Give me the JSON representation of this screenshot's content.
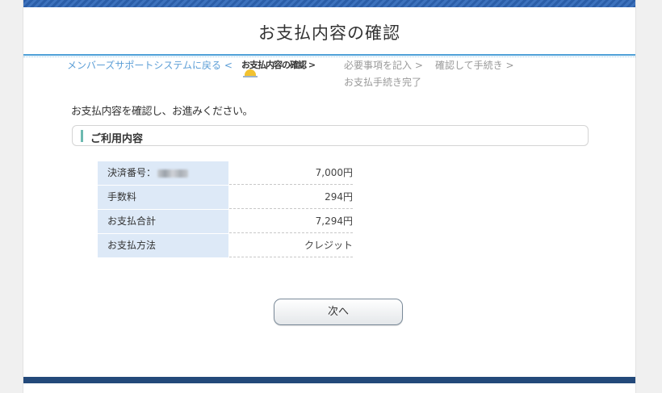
{
  "header": {
    "title": "お支払内容の確認"
  },
  "steps": {
    "back_link": "メンバーズサポートシステムに戻る <",
    "current": "お支払内容の確認 >",
    "step3": "必要事項を記入 >",
    "step4": "確認して手続き >",
    "step5": "お支払手続き完了"
  },
  "intro_text": "お支払内容を確認し、お進みください。",
  "section": {
    "title": "ご利用内容"
  },
  "details": [
    {
      "label": "決済番号：",
      "value": "7,000円"
    },
    {
      "label": "手数料",
      "value": "294円"
    },
    {
      "label": "お支払合計",
      "value": "7,294円"
    },
    {
      "label": "お支払方法",
      "value": "クレジット"
    }
  ],
  "buttons": {
    "next_label": "次へ"
  },
  "colors": {
    "header_band": "#2b5ea8",
    "footer_band": "#23497a",
    "label_bg": "#dde9f7",
    "link": "#5c9ed6",
    "section_accent": "#6cb9b0"
  }
}
